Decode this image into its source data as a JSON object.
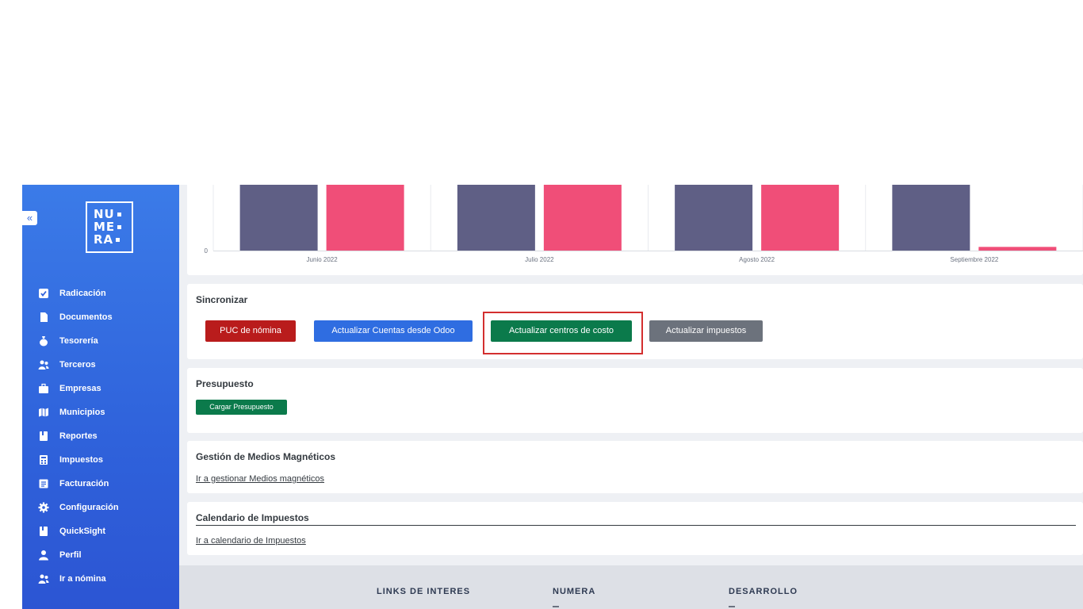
{
  "sidebar": {
    "collapse_icon": "double-chevron-left-icon",
    "logo_lines": [
      "NU",
      "ME",
      "RA"
    ],
    "items": [
      {
        "label": "Radicación",
        "icon": "checkbox-icon"
      },
      {
        "label": "Documentos",
        "icon": "document-icon"
      },
      {
        "label": "Tesorería",
        "icon": "money-bag-icon"
      },
      {
        "label": "Terceros",
        "icon": "users-icon"
      },
      {
        "label": "Empresas",
        "icon": "briefcase-icon"
      },
      {
        "label": "Municipios",
        "icon": "map-icon"
      },
      {
        "label": "Reportes",
        "icon": "book-icon"
      },
      {
        "label": "Impuestos",
        "icon": "calculator-icon"
      },
      {
        "label": "Facturación",
        "icon": "invoice-icon"
      },
      {
        "label": "Configuración",
        "icon": "gear-icon"
      },
      {
        "label": "QuickSight",
        "icon": "book-icon"
      },
      {
        "label": "Perfil",
        "icon": "user-icon"
      },
      {
        "label": "Ir a nómina",
        "icon": "users-icon"
      }
    ]
  },
  "chart_data": {
    "type": "bar",
    "categories": [
      "Junio 2022",
      "Julio 2022",
      "Agosto 2022",
      "Septiembre 2022"
    ],
    "y_tick_visible": "0",
    "series": [
      {
        "values": [
          100,
          100,
          100,
          90
        ],
        "color": "#5f5f85"
      },
      {
        "values": [
          100,
          100,
          100,
          5
        ],
        "color": "#f04e78"
      }
    ],
    "note_on_values": "relative heights only; top of chart is cut off in the screenshot",
    "grid": true
  },
  "sync": {
    "title": "Sincronizar",
    "buttons": [
      {
        "label": "PUC de nómina",
        "color": "#b91c1c"
      },
      {
        "label": "Actualizar Cuentas desde Odoo",
        "color": "#2f6de1"
      },
      {
        "label": "Actualizar centros de costo",
        "color": "#0b7a4b",
        "highlighted": true
      },
      {
        "label": "Actualizar impuestos",
        "color": "#6c727c"
      }
    ]
  },
  "budget": {
    "title": "Presupuesto",
    "button": "Cargar Presupuesto"
  },
  "media": {
    "title": "Gestión de Medios Magnéticos",
    "link": "Ir a gestionar Medios magnéticos"
  },
  "calendar": {
    "title": "Calendario de Impuestos",
    "link": "Ir a calendario de Impuestos"
  },
  "footer": {
    "columns": [
      "LINKS DE INTERES",
      "NUMERA",
      "DESARROLLO"
    ]
  }
}
